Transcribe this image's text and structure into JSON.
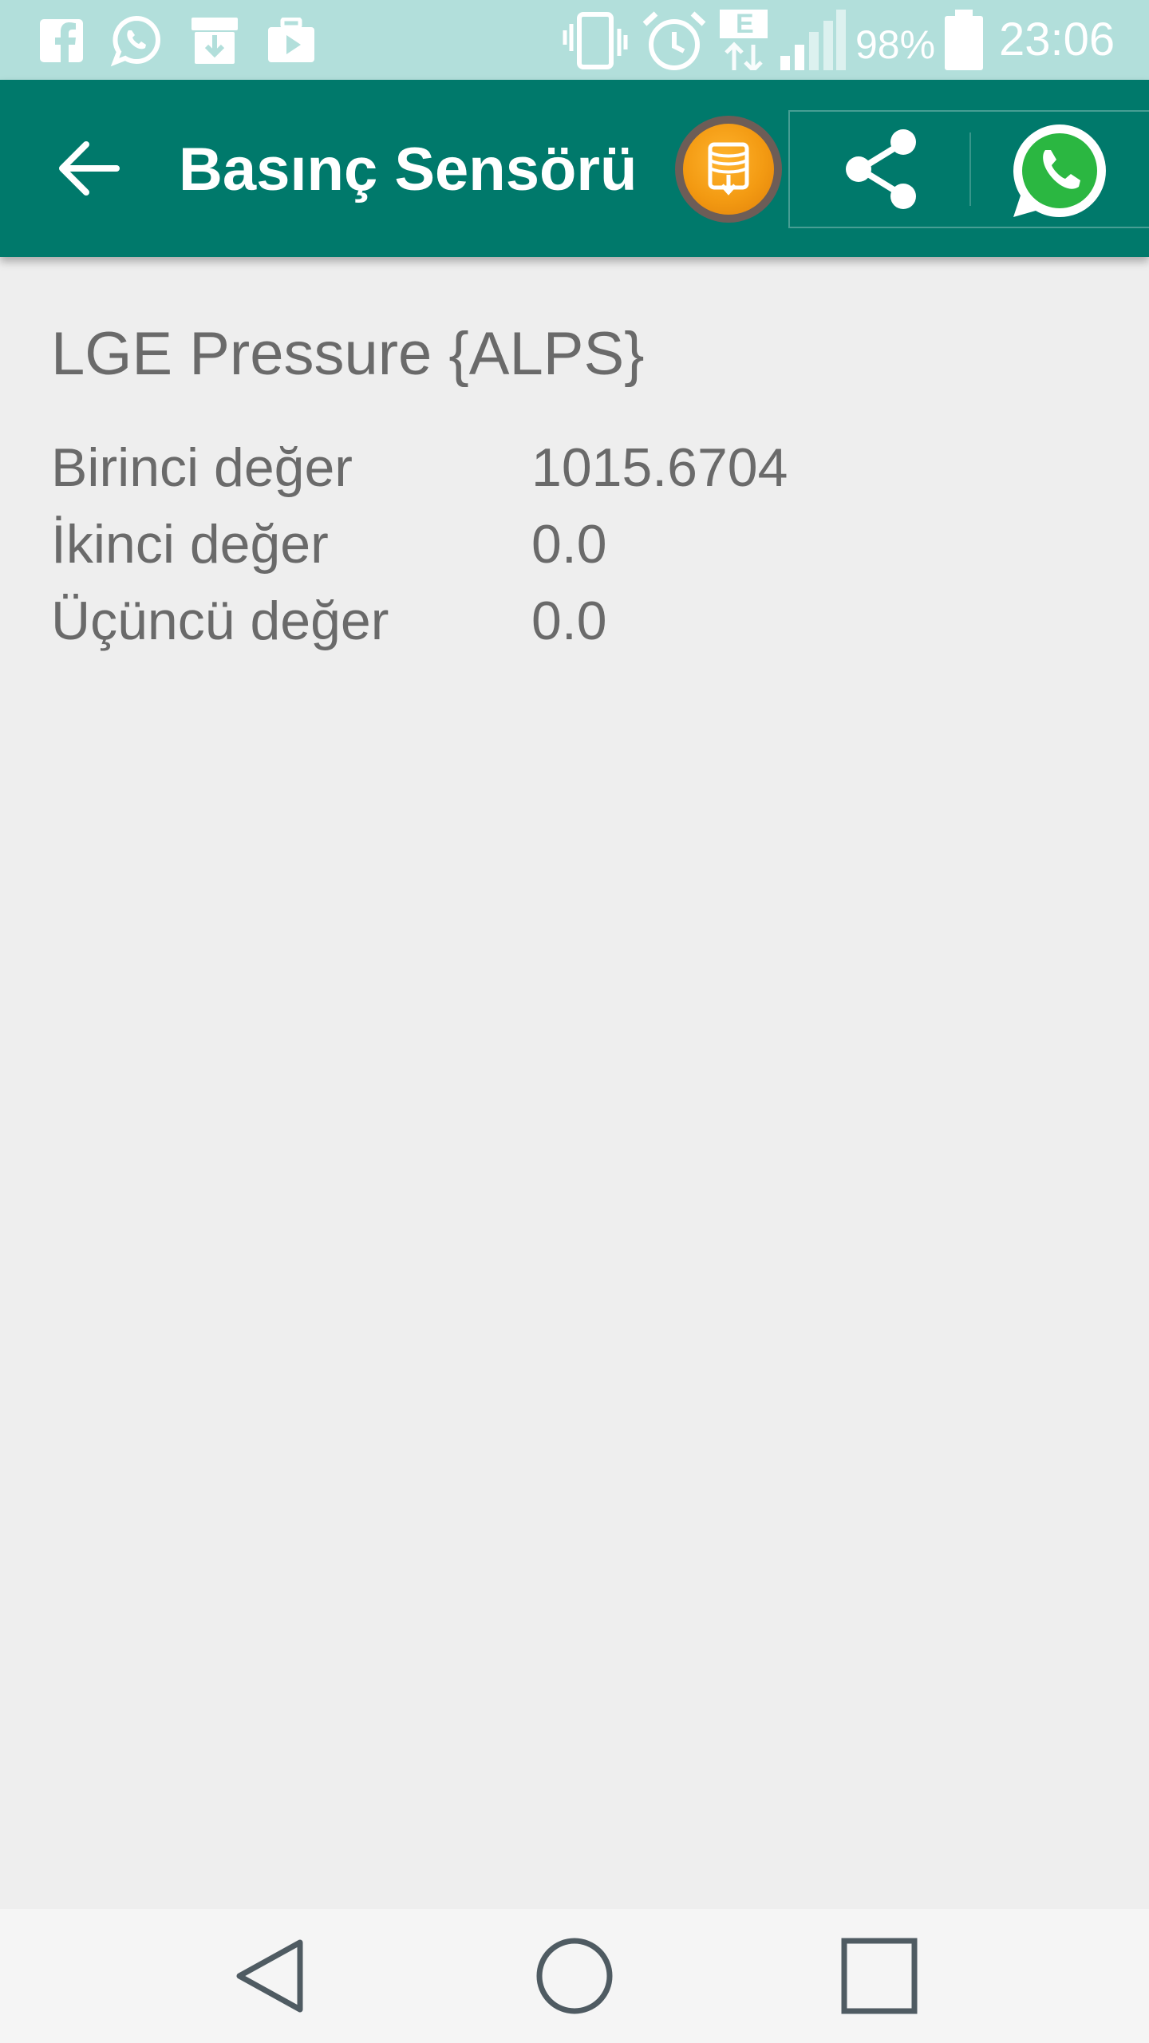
{
  "status_bar": {
    "battery_percent": "98%",
    "time": "23:06",
    "network_type": "E",
    "notification_icons": [
      "facebook-icon",
      "whatsapp-icon",
      "download-box-icon",
      "briefcase-play-icon"
    ],
    "system_icons": [
      "vibrate-icon",
      "alarm-icon",
      "data-arrows-icon",
      "signal-icon",
      "battery-icon"
    ]
  },
  "app_bar": {
    "title": "Basınç Sensörü",
    "color": "#00796b",
    "back_icon": "arrow-left-icon",
    "actions": [
      "ad-download-icon",
      "share-icon",
      "whatsapp-icon"
    ]
  },
  "sensor": {
    "name": "LGE Pressure {ALPS}",
    "values": [
      {
        "label": "Birinci değer",
        "value": "1015.6704"
      },
      {
        "label": "İkinci değer",
        "value": "0.0"
      },
      {
        "label": "Üçüncü değer",
        "value": "0.0"
      }
    ]
  },
  "nav_bar": {
    "buttons": [
      "back-triangle-icon",
      "home-circle-icon",
      "recents-square-icon"
    ]
  }
}
